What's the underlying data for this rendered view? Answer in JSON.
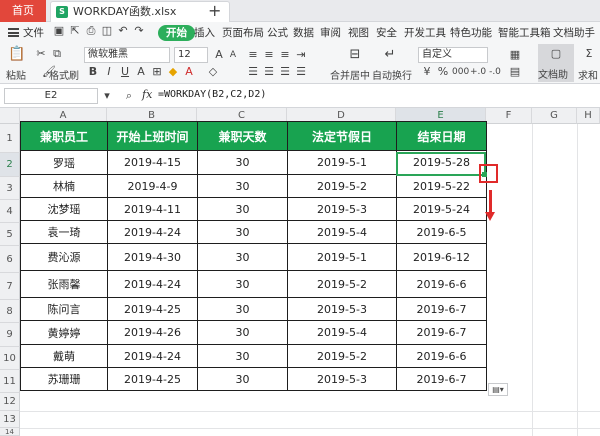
{
  "tabs": {
    "home": "首页",
    "file": "WORKDAY函数.xlsx",
    "new_tab": "+"
  },
  "menu": {
    "file": "文件",
    "items": [
      "开始",
      "插入",
      "页面布局",
      "公式",
      "数据",
      "审阅",
      "视图",
      "安全",
      "开发工具",
      "特色功能",
      "智能工具箱",
      "文档助手"
    ]
  },
  "ribbon": {
    "paste": "粘贴",
    "format_painter": "格式刷",
    "font_name": "微软雅黑",
    "font_size": "12",
    "merge_center": "合并居中",
    "wrap_text": "自动换行",
    "number_format": "自定义",
    "doc_assistant": "文档助手",
    "sum": "求和"
  },
  "formula_bar": {
    "cell_ref": "E2",
    "fx": "fx",
    "formula": "=WORKDAY(B2,C2,D2)"
  },
  "columns": [
    "A",
    "B",
    "C",
    "D",
    "E",
    "F",
    "G",
    "H"
  ],
  "selected_column": "E",
  "selected_row": "2",
  "rows": [
    "1",
    "2",
    "3",
    "4",
    "5",
    "6",
    "7",
    "8",
    "9",
    "10",
    "11",
    "12",
    "13",
    "14"
  ],
  "table": {
    "headers": [
      "兼职员工",
      "开始上班时间",
      "兼职天数",
      "法定节假日",
      "结束日期"
    ],
    "rows": [
      [
        "罗瑶",
        "2019-4-15",
        "30",
        "2019-5-1",
        "2019-5-28"
      ],
      [
        "林楠",
        "2019-4-9",
        "30",
        "2019-5-2",
        "2019-5-22"
      ],
      [
        "沈梦瑶",
        "2019-4-11",
        "30",
        "2019-5-3",
        "2019-5-24"
      ],
      [
        "袁一琦",
        "2019-4-24",
        "30",
        "2019-5-4",
        "2019-6-5"
      ],
      [
        "费沁源",
        "2019-4-30",
        "30",
        "2019-5-1",
        "2019-6-12"
      ],
      [
        "张雨馨",
        "2019-4-24",
        "30",
        "2019-5-2",
        "2019-6-6"
      ],
      [
        "陈问言",
        "2019-4-25",
        "30",
        "2019-5-3",
        "2019-6-7"
      ],
      [
        "黄婷婷",
        "2019-4-26",
        "30",
        "2019-5-4",
        "2019-6-7"
      ],
      [
        "戴萌",
        "2019-4-24",
        "30",
        "2019-5-2",
        "2019-6-6"
      ],
      [
        "苏珊珊",
        "2019-4-25",
        "30",
        "2019-5-3",
        "2019-6-7"
      ]
    ]
  },
  "colors": {
    "header_green": "#18a350",
    "selection_green": "#2aa558",
    "annotation_red": "#e02a2a",
    "home_tab_red": "#e2473b"
  }
}
